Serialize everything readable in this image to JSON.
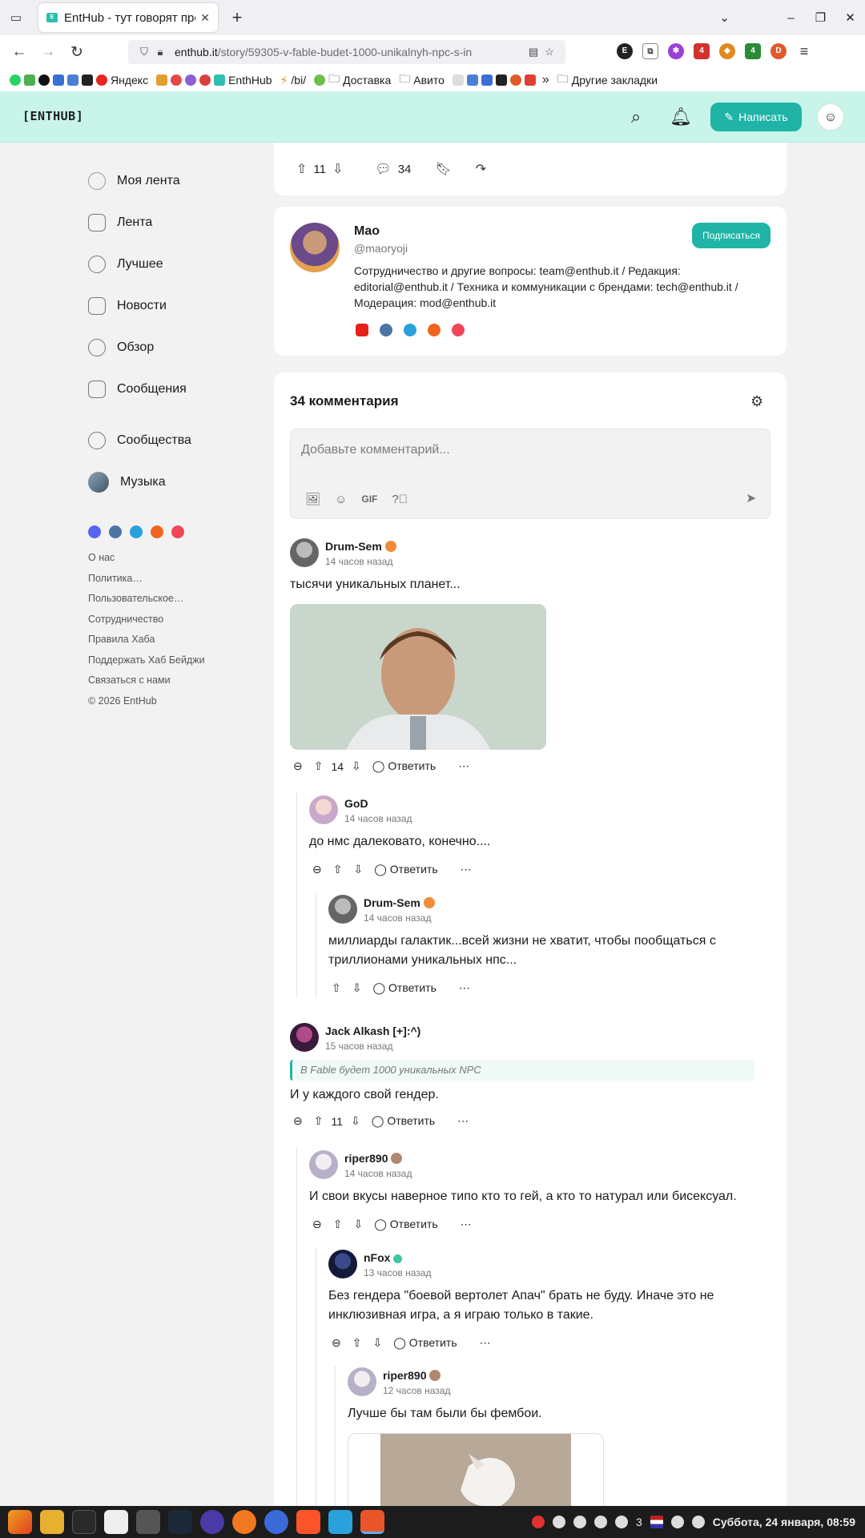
{
  "browser": {
    "tab_title": "EntHub - тут говорят про",
    "url_host": "enthub.it",
    "url_path": "/story/59305-v-fable-budet-1000-unikalnyh-npc-s-in",
    "bookmarks": [
      "Яндекс",
      "EnthHub",
      "/bi/",
      "Доставка",
      "Авито",
      "Другие закладки"
    ],
    "ext_badges": [
      "4",
      "4"
    ]
  },
  "site": {
    "logo": "[ENTHUB]",
    "write_label": "Написать"
  },
  "sidebar": {
    "items": [
      {
        "label": "Моя лента"
      },
      {
        "label": "Лента"
      },
      {
        "label": "Лучшее"
      },
      {
        "label": "Новости"
      },
      {
        "label": "Обзор"
      },
      {
        "label": "Сообщения"
      },
      {
        "label": "Сообщества"
      },
      {
        "label": "Музыка"
      }
    ],
    "footer": [
      "О нас",
      "Политика…",
      "Пользовательское…",
      "Сотрудничество",
      "Правила Хаба",
      "Поддержать Хаб  Бейджи",
      "Связаться с нами",
      "© 2026 EntHub"
    ]
  },
  "post": {
    "score": "11",
    "comments": "34"
  },
  "author": {
    "name": "Mao",
    "handle": "@maoryoji",
    "bio": "Сотрудничество и другие вопросы: team@enthub.it / Редакция: editorial@enthub.it / Техника и коммуникации с брендами: tech@enthub.it / Модерация: mod@enthub.it",
    "subscribe_label": "Подписаться"
  },
  "comments": {
    "title": "34 комментария",
    "placeholder": "Добавьте комментарий...",
    "gif_label": "GIF",
    "reply_label": "Ответить",
    "items": [
      {
        "author": "Drum-Sem",
        "time": "14 часов назад",
        "text": "тысячи уникальных планет...",
        "score": "14"
      },
      {
        "author": "GoD",
        "time": "14 часов назад",
        "text": "до нмс далековато, конечно...."
      },
      {
        "author": "Drum-Sem",
        "time": "14 часов назад",
        "text_1": "миллиарды галактик...всей жизни не хватит, чтобы пообщаться с",
        "text_2": "триллионами уникальных нпс..."
      },
      {
        "author": "Jack Alkash [+]:^)",
        "time": "15 часов назад",
        "quote": "В Fable будет 1000 уникальных NPC",
        "text": "И у каждого свой гендер.",
        "score": "11"
      },
      {
        "author": "riper890",
        "time": "14 часов назад",
        "text": "И свои вкусы наверное типо кто то гей, а кто то натурал или бисексуал."
      },
      {
        "author": "nFox",
        "time": "13 часов назад",
        "text_1": "Без гендера \"боевой вертолет Апач\" брать не буду. Иначе это не",
        "text_2": "инклюзивная игра, а я играю только в такие."
      },
      {
        "author": "riper890",
        "time": "12 часов назад",
        "text": "Лучше бы там были бы фембои."
      }
    ]
  },
  "taskbar": {
    "count": "3",
    "datetime": "Суббота, 24 января, 08:59"
  }
}
